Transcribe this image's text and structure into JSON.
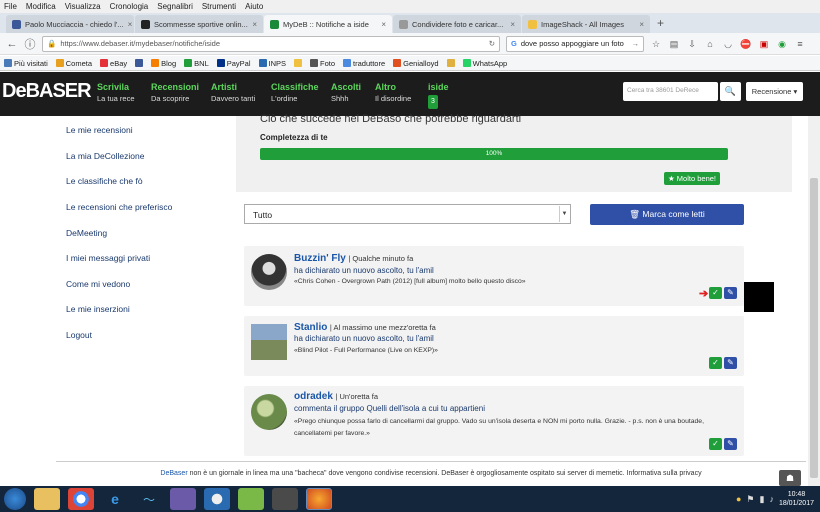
{
  "menubar": [
    "File",
    "Modifica",
    "Visualizza",
    "Cronologia",
    "Segnalibri",
    "Strumenti",
    "Aiuto"
  ],
  "tabs": [
    {
      "label": "Paolo Mucciaccia - chiedo l'...",
      "color": "#3b5998",
      "active": false
    },
    {
      "label": "Scommesse sportive onlin...",
      "color": "#222222",
      "active": false
    },
    {
      "label": "MyDeB :: Notifiche a iside",
      "color": "#1a8a3a",
      "active": true
    },
    {
      "label": "Condividere foto e caricar...",
      "color": "#999999",
      "active": false
    },
    {
      "label": "ImageShack - All Images",
      "color": "#f0c040",
      "active": false
    }
  ],
  "newtab": "+",
  "nav": {
    "url": "https://www.debaser.it/mydebaser/notifiche/iside",
    "search": "dove posso appoggiare un foto"
  },
  "bookmarks": [
    {
      "label": "Più visitati",
      "color": "#4a7ab8"
    },
    {
      "label": "Cometa",
      "color": "#e8a020"
    },
    {
      "label": "eBay",
      "color": "#e53238"
    },
    {
      "label": "",
      "color": "#3b5998"
    },
    {
      "label": "Blog",
      "color": "#f57d00"
    },
    {
      "label": "BNL",
      "color": "#1f9e3a"
    },
    {
      "label": "PayPal",
      "color": "#003087"
    },
    {
      "label": "INPS",
      "color": "#2a6ab0"
    },
    {
      "label": "",
      "color": "#f0c040"
    },
    {
      "label": "Foto",
      "color": "#555555"
    },
    {
      "label": "traduttore",
      "color": "#4a8ae0"
    },
    {
      "label": "Genialloyd",
      "color": "#e05020"
    },
    {
      "label": "",
      "color": "#e0b040"
    },
    {
      "label": "WhatsApp",
      "color": "#25d366"
    }
  ],
  "site": {
    "logo": "DeBASER",
    "nav": [
      {
        "title": "Scrivila",
        "sub": "La tua rece"
      },
      {
        "title": "Recensioni",
        "sub": "Da scoprire"
      },
      {
        "title": "Artisti",
        "sub": "Davvero tanti"
      },
      {
        "title": "Classifiche",
        "sub": "L'ordine"
      },
      {
        "title": "Ascolti",
        "sub": "Shhh"
      },
      {
        "title": "Altro",
        "sub": "Il disordine"
      },
      {
        "title": "iside",
        "sub": "3"
      }
    ],
    "search_placeholder": "Cerca tra 38601 DeRece",
    "recensione_btn": "Recensione ▾"
  },
  "sidebar": [
    "Le mie recensioni",
    "La mia DeCollezione",
    "Le classifiche che fò",
    "Le recensioni che preferisco",
    "DeMeeting",
    "I miei messaggi privati",
    "Come mi vedono",
    "Le mie inserzioni",
    "Logout"
  ],
  "completeness": {
    "heading": "Ciò che succede nel DeBaso che potrebbe riguardarti",
    "label": "Completezza di te",
    "percent_text": "100%",
    "percent": 100,
    "badge": "★ Molto bene!"
  },
  "filter": {
    "value": "Tutto",
    "mark_read": "🗑 Marca come letti"
  },
  "notifications": [
    {
      "user": "Buzzin' Fly",
      "time": "| Qualche minuto fa",
      "action": "ha dichiarato un nuovo ascolto, tu l'amil",
      "quote": "«Chris Cohen - Overgrown Path (2012) [full album] molto bello questo disco»"
    },
    {
      "user": "Stanlio",
      "time": "| Al massimo une mezz'oretta fa",
      "action": "ha dichiarato un nuovo ascolto, tu l'amil",
      "quote": "«Blind Pilot - Full Performance (Live on KEXP)»"
    },
    {
      "user": "odradek",
      "time": "| Un'oretta fa",
      "action": "commenta il gruppo Quelli dell'isola a cui tu appartieni",
      "quote": "«Prego chiunque possa farlo di cancellarmi dal gruppo. Vado su un'isola deserta e NON mi porto nulla. Grazie. - p.s. non è una boutade, cancellatemi per favore.»"
    }
  ],
  "footer": {
    "brand": "DeBaser",
    "text": " non è un giornale in linea ma una \"bacheca\" dove vengono condivise recensioni. DeBaser è orgogliosamente ospitato sui server di memetic. Informativa sulla privacy"
  },
  "taskbar": {
    "time": "10:48",
    "date": "18/01/2017"
  },
  "colors": {
    "brand_green": "#5cd65c",
    "progress": "#1f9e3a",
    "primary_button": "#3050a8",
    "header": "#1c1c1c"
  }
}
